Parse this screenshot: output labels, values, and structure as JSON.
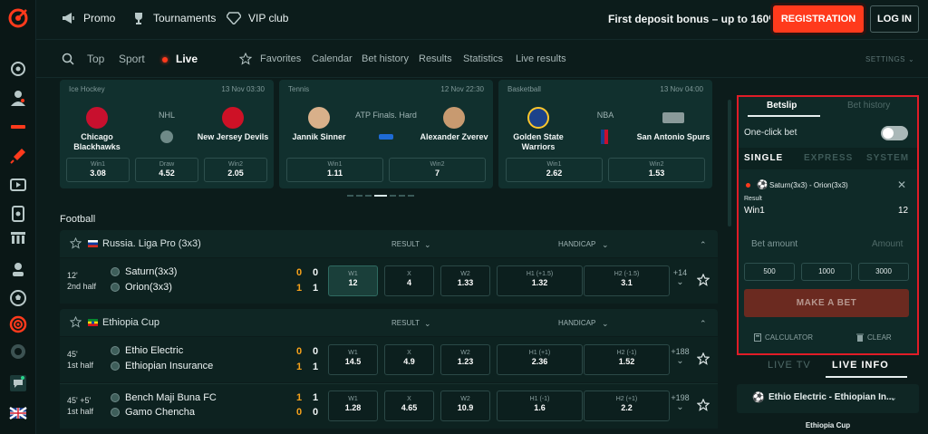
{
  "topbar": {
    "promo": "Promo",
    "tournaments": "Tournaments",
    "vip": "VIP club",
    "bonus": "First deposit bonus – up to 160%",
    "registration": "REGISTRATION",
    "login": "LOG IN"
  },
  "subnav": {
    "top": "Top",
    "sport": "Sport",
    "live": "Live",
    "favorites": "Favorites",
    "calendar": "Calendar",
    "bet_history": "Bet history",
    "results": "Results",
    "statistics": "Statistics",
    "live_results": "Live results",
    "settings": "SETTINGS"
  },
  "featured": [
    {
      "sport": "Ice Hockey",
      "date": "13 Nov 03:30",
      "league": "NHL",
      "team1": "Chicago Blackhawks",
      "team2": "New Jersey Devils",
      "odds": [
        {
          "label": "Win1",
          "value": "3.08"
        },
        {
          "label": "Draw",
          "value": "4.52"
        },
        {
          "label": "Win2",
          "value": "2.05"
        }
      ]
    },
    {
      "sport": "Tennis",
      "date": "12 Nov 22:30",
      "league": "ATP Finals. Hard",
      "team1": "Jannik Sinner",
      "team2": "Alexander Zverev",
      "odds": [
        {
          "label": "Win1",
          "value": "1.11"
        },
        {
          "label": "Win2",
          "value": "7"
        }
      ]
    },
    {
      "sport": "Basketball",
      "date": "13 Nov 04:00",
      "league": "NBA",
      "team1": "Golden State Warriors",
      "team2": "San Antonio Spurs",
      "odds": [
        {
          "label": "Win1",
          "value": "2.62"
        },
        {
          "label": "Win2",
          "value": "1.53"
        }
      ]
    }
  ],
  "section": "Football",
  "leagues": [
    {
      "name": "Russia. Liga Pro (3x3)",
      "col1": "RESULT",
      "col2": "HANDICAP",
      "matches": [
        {
          "time": "12'",
          "period": "2nd half",
          "team1": "Saturn(3x3)",
          "team2": "Orion(3x3)",
          "s1a": "0",
          "s1b": "0",
          "s2a": "1",
          "s2b": "1",
          "odds": [
            {
              "label": "W1",
              "value": "12"
            },
            {
              "label": "X",
              "value": "4"
            },
            {
              "label": "W2",
              "value": "1.33"
            },
            {
              "label": "H1 (+1.5)",
              "value": "1.32"
            },
            {
              "label": "H2 (-1.5)",
              "value": "3.1"
            }
          ],
          "more": "+14"
        }
      ]
    },
    {
      "name": "Ethiopia Cup",
      "col1": "RESULT",
      "col2": "HANDICAP",
      "matches": [
        {
          "time": "45'",
          "period": "1st half",
          "team1": "Ethio Electric",
          "team2": "Ethiopian Insurance",
          "s1a": "0",
          "s1b": "0",
          "s2a": "1",
          "s2b": "1",
          "odds": [
            {
              "label": "W1",
              "value": "14.5"
            },
            {
              "label": "X",
              "value": "4.9"
            },
            {
              "label": "W2",
              "value": "1.23"
            },
            {
              "label": "H1 (+1)",
              "value": "2.36"
            },
            {
              "label": "H2 (-1)",
              "value": "1.52"
            }
          ],
          "more": "+188"
        },
        {
          "time": "45' +5'",
          "period": "1st half",
          "team1": "Bench Maji Buna FC",
          "team2": "Gamo Chencha",
          "s1a": "1",
          "s1b": "1",
          "s2a": "0",
          "s2b": "0",
          "odds": [
            {
              "label": "W1",
              "value": "1.28"
            },
            {
              "label": "X",
              "value": "4.65"
            },
            {
              "label": "W2",
              "value": "10.9"
            },
            {
              "label": "H1 (-1)",
              "value": "1.6"
            },
            {
              "label": "H2 (+1)",
              "value": "2.2"
            }
          ],
          "more": "+198"
        }
      ]
    }
  ],
  "betslip": {
    "tab_active": "Betslip",
    "tab_history": "Bet history",
    "one_click": "One-click bet",
    "single": "SINGLE",
    "express": "EXPRESS",
    "system": "SYSTEM",
    "event": "Saturn(3x3) - Orion(3x3)",
    "result_label": "Result",
    "outcome": "Win1",
    "odds": "12",
    "bet_amount": "Bet amount",
    "amount_placeholder": "Amount",
    "quick": [
      "500",
      "1000",
      "3000"
    ],
    "make_bet": "MAKE A BET",
    "calculator": "CALCULATOR",
    "clear": "CLEAR"
  },
  "live_panel": {
    "live_tv": "LIVE TV",
    "live_info": "LIVE INFO",
    "match": "Ethio Electric - Ethiopian In...",
    "league": "Ethiopia Cup"
  }
}
